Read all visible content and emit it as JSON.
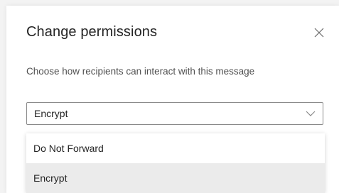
{
  "dialog": {
    "title": "Change permissions",
    "description": "Choose how recipients can interact with this message",
    "close_icon": "close-icon"
  },
  "permission_select": {
    "selected_value": "Encrypt",
    "chevron_icon": "chevron-down-icon",
    "options": [
      {
        "label": "Do Not Forward",
        "highlighted": false
      },
      {
        "label": "Encrypt",
        "highlighted": true
      }
    ]
  },
  "colors": {
    "dialog_background": "#ffffff",
    "highlight": "#ebebeb",
    "text": "#242424",
    "border": "#8a8a8a"
  }
}
